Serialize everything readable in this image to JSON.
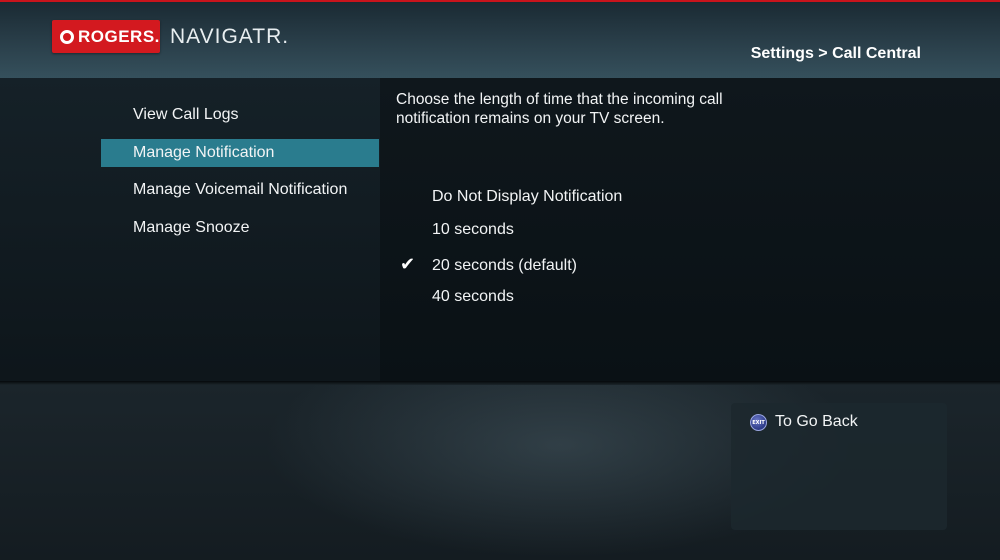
{
  "header": {
    "brand": "ROGERS.",
    "product": "NAVIGATR.",
    "breadcrumb": "Settings > Call Central"
  },
  "menu": {
    "items": [
      {
        "label": "View Call Logs",
        "selected": false
      },
      {
        "label": "Manage Notification",
        "selected": true
      },
      {
        "label": "Manage Voicemail Notification",
        "selected": false
      },
      {
        "label": "Manage Snooze",
        "selected": false
      }
    ]
  },
  "content": {
    "description_line1": "Choose the length of time that the incoming call",
    "description_line2": "notification remains on your TV screen.",
    "options": [
      {
        "label": "Do Not Display Notification",
        "checked": false
      },
      {
        "label": "10 seconds",
        "checked": false
      },
      {
        "label": "20 seconds (default)",
        "checked": true
      },
      {
        "label": "40 seconds",
        "checked": false
      }
    ]
  },
  "help": {
    "exit_icon_label": "EXIT",
    "go_back": "To Go Back"
  },
  "colors": {
    "brand_red": "#d3191f",
    "selection_teal": "#2a7c8e"
  },
  "icons": {
    "check": "check-icon",
    "exit": "exit-button-icon",
    "logo": "rogers-logo-icon"
  }
}
